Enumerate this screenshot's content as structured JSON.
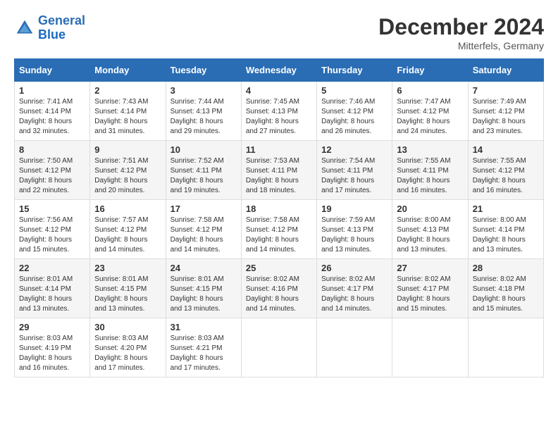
{
  "logo": {
    "line1": "General",
    "line2": "Blue"
  },
  "title": "December 2024",
  "location": "Mitterfels, Germany",
  "days_of_week": [
    "Sunday",
    "Monday",
    "Tuesday",
    "Wednesday",
    "Thursday",
    "Friday",
    "Saturday"
  ],
  "weeks": [
    [
      {
        "day": "1",
        "sunrise": "7:41 AM",
        "sunset": "4:14 PM",
        "daylight": "8 hours and 32 minutes."
      },
      {
        "day": "2",
        "sunrise": "7:43 AM",
        "sunset": "4:14 PM",
        "daylight": "8 hours and 31 minutes."
      },
      {
        "day": "3",
        "sunrise": "7:44 AM",
        "sunset": "4:13 PM",
        "daylight": "8 hours and 29 minutes."
      },
      {
        "day": "4",
        "sunrise": "7:45 AM",
        "sunset": "4:13 PM",
        "daylight": "8 hours and 27 minutes."
      },
      {
        "day": "5",
        "sunrise": "7:46 AM",
        "sunset": "4:12 PM",
        "daylight": "8 hours and 26 minutes."
      },
      {
        "day": "6",
        "sunrise": "7:47 AM",
        "sunset": "4:12 PM",
        "daylight": "8 hours and 24 minutes."
      },
      {
        "day": "7",
        "sunrise": "7:49 AM",
        "sunset": "4:12 PM",
        "daylight": "8 hours and 23 minutes."
      }
    ],
    [
      {
        "day": "8",
        "sunrise": "7:50 AM",
        "sunset": "4:12 PM",
        "daylight": "8 hours and 22 minutes."
      },
      {
        "day": "9",
        "sunrise": "7:51 AM",
        "sunset": "4:12 PM",
        "daylight": "8 hours and 20 minutes."
      },
      {
        "day": "10",
        "sunrise": "7:52 AM",
        "sunset": "4:11 PM",
        "daylight": "8 hours and 19 minutes."
      },
      {
        "day": "11",
        "sunrise": "7:53 AM",
        "sunset": "4:11 PM",
        "daylight": "8 hours and 18 minutes."
      },
      {
        "day": "12",
        "sunrise": "7:54 AM",
        "sunset": "4:11 PM",
        "daylight": "8 hours and 17 minutes."
      },
      {
        "day": "13",
        "sunrise": "7:55 AM",
        "sunset": "4:11 PM",
        "daylight": "8 hours and 16 minutes."
      },
      {
        "day": "14",
        "sunrise": "7:55 AM",
        "sunset": "4:12 PM",
        "daylight": "8 hours and 16 minutes."
      }
    ],
    [
      {
        "day": "15",
        "sunrise": "7:56 AM",
        "sunset": "4:12 PM",
        "daylight": "8 hours and 15 minutes."
      },
      {
        "day": "16",
        "sunrise": "7:57 AM",
        "sunset": "4:12 PM",
        "daylight": "8 hours and 14 minutes."
      },
      {
        "day": "17",
        "sunrise": "7:58 AM",
        "sunset": "4:12 PM",
        "daylight": "8 hours and 14 minutes."
      },
      {
        "day": "18",
        "sunrise": "7:58 AM",
        "sunset": "4:12 PM",
        "daylight": "8 hours and 14 minutes."
      },
      {
        "day": "19",
        "sunrise": "7:59 AM",
        "sunset": "4:13 PM",
        "daylight": "8 hours and 13 minutes."
      },
      {
        "day": "20",
        "sunrise": "8:00 AM",
        "sunset": "4:13 PM",
        "daylight": "8 hours and 13 minutes."
      },
      {
        "day": "21",
        "sunrise": "8:00 AM",
        "sunset": "4:14 PM",
        "daylight": "8 hours and 13 minutes."
      }
    ],
    [
      {
        "day": "22",
        "sunrise": "8:01 AM",
        "sunset": "4:14 PM",
        "daylight": "8 hours and 13 minutes."
      },
      {
        "day": "23",
        "sunrise": "8:01 AM",
        "sunset": "4:15 PM",
        "daylight": "8 hours and 13 minutes."
      },
      {
        "day": "24",
        "sunrise": "8:01 AM",
        "sunset": "4:15 PM",
        "daylight": "8 hours and 13 minutes."
      },
      {
        "day": "25",
        "sunrise": "8:02 AM",
        "sunset": "4:16 PM",
        "daylight": "8 hours and 14 minutes."
      },
      {
        "day": "26",
        "sunrise": "8:02 AM",
        "sunset": "4:17 PM",
        "daylight": "8 hours and 14 minutes."
      },
      {
        "day": "27",
        "sunrise": "8:02 AM",
        "sunset": "4:17 PM",
        "daylight": "8 hours and 15 minutes."
      },
      {
        "day": "28",
        "sunrise": "8:02 AM",
        "sunset": "4:18 PM",
        "daylight": "8 hours and 15 minutes."
      }
    ],
    [
      {
        "day": "29",
        "sunrise": "8:03 AM",
        "sunset": "4:19 PM",
        "daylight": "8 hours and 16 minutes."
      },
      {
        "day": "30",
        "sunrise": "8:03 AM",
        "sunset": "4:20 PM",
        "daylight": "8 hours and 17 minutes."
      },
      {
        "day": "31",
        "sunrise": "8:03 AM",
        "sunset": "4:21 PM",
        "daylight": "8 hours and 17 minutes."
      },
      null,
      null,
      null,
      null
    ]
  ],
  "labels": {
    "sunrise": "Sunrise:",
    "sunset": "Sunset:",
    "daylight": "Daylight:"
  }
}
